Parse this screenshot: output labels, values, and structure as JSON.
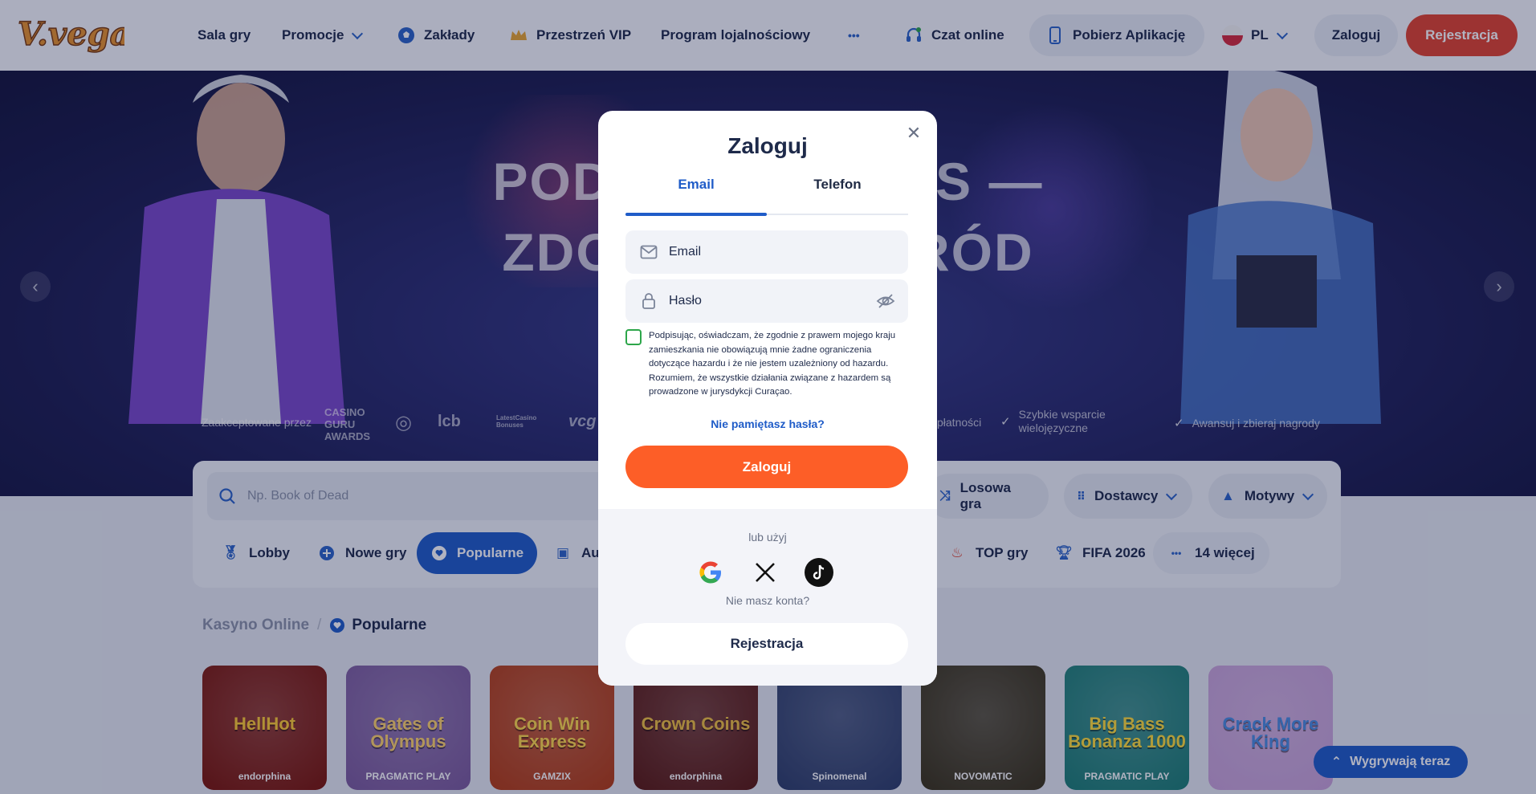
{
  "brand": {
    "logo_text": "V.vegas",
    "accent": "#e0432e",
    "primary": "#1f5cc8",
    "login_orange": "#fd5e27"
  },
  "nav": {
    "sala_gry": "Sala gry",
    "promocje": "Promocje",
    "zaklady": "Zakłady",
    "vip": "Przestrzeń VIP",
    "program": "Program lojalnościowy",
    "more": "•••",
    "chat": "Czat online",
    "app": "Pobierz Aplikację",
    "lang": "PL",
    "login": "Zaloguj",
    "register": "Rejestracja"
  },
  "hero": {
    "line1": "PODNIEŚ STATUS —",
    "line2": "ZDOBĄDŹ NAGRÓD",
    "accepted_by": "Zaakceptowane przez",
    "partner_logos": [
      "CASINO GURU AWARDS",
      "lcb",
      "LatestCasino Bonuses",
      "vcg"
    ],
    "trust_payments": "płatności",
    "trust_support": "Szybkie wsparcie wielojęzyczne",
    "trust_rewards": "Awansuj i zbieraj nagrody"
  },
  "search": {
    "placeholder": "Np. Book of Dead"
  },
  "filters": {
    "random": "Losowa gra",
    "providers": "Dostawcy",
    "themes": "Motywy"
  },
  "categories": {
    "lobby": "Lobby",
    "new": "Nowe gry",
    "popular": "Popularne",
    "auto": "Au",
    "top": "TOP gry",
    "fifa": "FIFA 2026",
    "more": "14 więcej"
  },
  "breadcrumb": {
    "root": "Kasyno Online",
    "sep": "/",
    "current": "Popularne"
  },
  "games": [
    {
      "title": "HellHot",
      "provider": "endorphina",
      "bg": "#7a1408",
      "fg": "#ffcc33"
    },
    {
      "title": "Gates of Olympus",
      "provider": "PRAGMATIC PLAY",
      "bg": "#7b5a9c",
      "fg": "#ffd36b"
    },
    {
      "title": "Coin Win Express",
      "provider": "GAMZIX",
      "bg": "#b33a12",
      "fg": "#ffd84a"
    },
    {
      "title": "Crown Coins",
      "provider": "endorphina",
      "bg": "#5a1810",
      "fg": "#f0c040"
    },
    {
      "title": "",
      "provider": "Spinomenal",
      "bg": "#2d3d68",
      "fg": "#ffffff"
    },
    {
      "title": "",
      "provider": "NOVOMATIC",
      "bg": "#3a3218",
      "fg": "#ffffff"
    },
    {
      "title": "Big Bass Bonanza 1000",
      "provider": "PRAGMATIC PLAY",
      "bg": "#1b7d74",
      "fg": "#ffdd3a"
    },
    {
      "title": "Crack More King",
      "provider": "",
      "bg": "#c9a2d8",
      "fg": "#4a8de0"
    }
  ],
  "winners": {
    "label": "Wygrywają teraz"
  },
  "modal": {
    "title": "Zaloguj",
    "tab_email": "Email",
    "tab_phone": "Telefon",
    "email_placeholder": "Email",
    "password_placeholder": "Hasło",
    "terms": "Podpisując, oświadczam, że zgodnie z prawem mojego kraju zamieszkania nie obowiązują mnie żadne ograniczenia dotyczące hazardu i że nie jestem uzależniony od hazardu. Rozumiem, że wszystkie działania związane z hazardem są prowadzone w jurysdykcji Curaçao.",
    "forgot": "Nie pamiętasz hasła?",
    "login_button": "Zaloguj",
    "or_use": "lub użyj",
    "no_account": "Nie masz konta?",
    "register_button": "Rejestracja"
  }
}
